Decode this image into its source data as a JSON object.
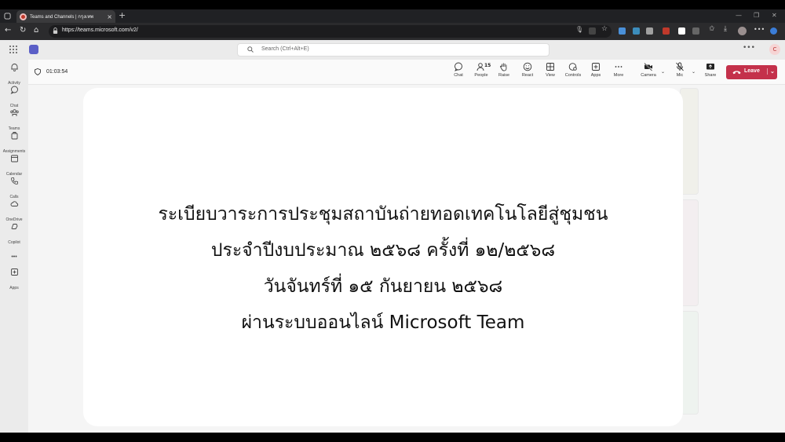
{
  "browser": {
    "tab_title": "Teams and Channels | กรุงเทพ",
    "url": "https://teams.microsoft.com/v2/"
  },
  "teams": {
    "search_placeholder": "Search (Ctrl+Alt+E)",
    "avatar_initial": "C"
  },
  "rail": {
    "items": [
      {
        "label": "Activity",
        "icon": "bell-icon"
      },
      {
        "label": "Chat",
        "icon": "chat-icon"
      },
      {
        "label": "Teams",
        "icon": "teams-icon"
      },
      {
        "label": "Assignments",
        "icon": "assignments-icon"
      },
      {
        "label": "Calendar",
        "icon": "calendar-icon"
      },
      {
        "label": "Calls",
        "icon": "phone-icon"
      },
      {
        "label": "OneDrive",
        "icon": "cloud-icon"
      },
      {
        "label": "Copilot",
        "icon": "copilot-icon"
      },
      {
        "label": "Apps",
        "icon": "add-apps-icon"
      }
    ],
    "more_label": "•••"
  },
  "meeting": {
    "timer": "01:03:54",
    "people_count": "15",
    "tools": {
      "chat": "Chat",
      "people": "People",
      "raise": "Raise",
      "react": "React",
      "view": "View",
      "controls": "Controls",
      "apps": "Apps",
      "more": "More",
      "camera": "Camera",
      "mic": "Mic",
      "share": "Share"
    },
    "leave_label": "Leave",
    "leave_color": "#c4314b"
  },
  "slide": {
    "lines": [
      "ระเบียบวาระการประชุมสถาบันถ่ายทอดเทคโนโลยีสู่ชุมชน",
      "ประจำปีงบประมาณ ๒๕๖๘ ครั้งที่ ๑๒/๒๕๖๘",
      "วันจันทร์ที่ ๑๕ กันยายน ๒๕๖๘",
      "ผ่านระบบออนไลน์ Microsoft Team"
    ]
  },
  "colors": {
    "teams_accent": "#5b5fc7",
    "leave": "#c4314b"
  }
}
